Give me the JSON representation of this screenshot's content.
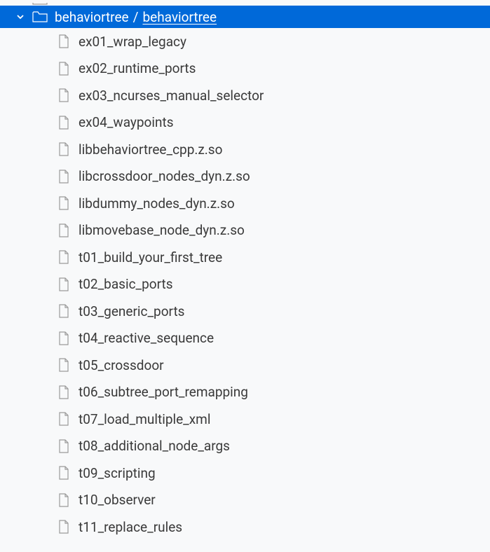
{
  "tree": {
    "parent_partial": {
      "chevron": "right",
      "name": ""
    },
    "selected_folder": {
      "chevron": "down",
      "breadcrumb": [
        {
          "text": "behaviortree",
          "underline": false
        },
        {
          "text": "behaviortree",
          "underline": true
        }
      ],
      "separator": "/"
    },
    "files": [
      {
        "name": "ex01_wrap_legacy"
      },
      {
        "name": "ex02_runtime_ports"
      },
      {
        "name": "ex03_ncurses_manual_selector"
      },
      {
        "name": "ex04_waypoints"
      },
      {
        "name": "libbehaviortree_cpp.z.so"
      },
      {
        "name": "libcrossdoor_nodes_dyn.z.so"
      },
      {
        "name": "libdummy_nodes_dyn.z.so"
      },
      {
        "name": "libmovebase_node_dyn.z.so"
      },
      {
        "name": "t01_build_your_first_tree"
      },
      {
        "name": "t02_basic_ports"
      },
      {
        "name": "t03_generic_ports"
      },
      {
        "name": "t04_reactive_sequence"
      },
      {
        "name": "t05_crossdoor"
      },
      {
        "name": "t06_subtree_port_remapping"
      },
      {
        "name": "t07_load_multiple_xml"
      },
      {
        "name": "t08_additional_node_args"
      },
      {
        "name": "t09_scripting"
      },
      {
        "name": "t10_observer"
      },
      {
        "name": "t11_replace_rules"
      }
    ]
  }
}
